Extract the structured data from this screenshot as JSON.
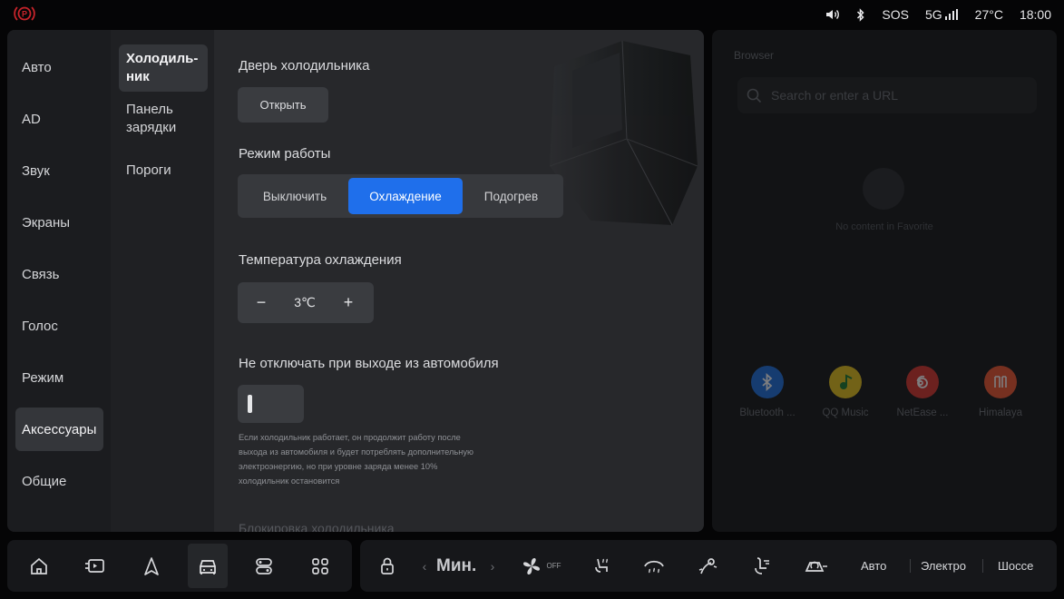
{
  "status_bar": {
    "icons": [
      "parking-brake-icon",
      "volume-icon",
      "bluetooth-icon",
      "signal-icon"
    ],
    "sos": "SOS",
    "network": "5G",
    "temperature": "27°C",
    "time": "18:00",
    "accent_color": "#c8242b"
  },
  "nav_primary": [
    {
      "label": "Авто"
    },
    {
      "label": "AD"
    },
    {
      "label": "Звук"
    },
    {
      "label": "Экраны"
    },
    {
      "label": "Связь"
    },
    {
      "label": "Голос"
    },
    {
      "label": "Режим"
    },
    {
      "label": "Аксессуары",
      "active": true
    },
    {
      "label": "Общие"
    }
  ],
  "nav_secondary": [
    {
      "label": "Холодиль-\nник",
      "active": true
    },
    {
      "label": "Панель\nзарядки"
    },
    {
      "label": "Пороги"
    }
  ],
  "fridge": {
    "door_label": "Дверь холодильника",
    "open_button": "Открыть",
    "mode_label": "Режим работы",
    "modes": [
      "Выключить",
      "Охлаждение",
      "Подогрев"
    ],
    "selected_mode": "Охлаждение",
    "temp_label": "Температура охлаждения",
    "temp_value": "3℃",
    "keep_on_label": "Не отключать при выходе из автомобиля",
    "keep_on_enabled": false,
    "keep_on_hint": "Если холодильник работает, он продолжит работу после выхода из автомобиля и будет потреблять дополнительную электроэнергию, но при уровне заряда менее 10% холодильник остановится",
    "lock_label": "Блокировка холодильника",
    "accent_color": "#1f6feb"
  },
  "browser": {
    "title": "Browser",
    "search_placeholder": "Search or enter a URL",
    "empty_text": "No content in Favorite",
    "apps": [
      {
        "name": "Bluetooth ...",
        "icon": "bluetooth-icon",
        "color": "#1d6fe0"
      },
      {
        "name": "QQ Music",
        "icon": "music-note-icon",
        "color": "#e8c21a"
      },
      {
        "name": "NetEase ...",
        "icon": "netease-icon",
        "color": "#d9322c"
      },
      {
        "name": "Himalaya",
        "icon": "himalaya-icon",
        "color": "#f0552f"
      }
    ]
  },
  "dock": {
    "left_icons": [
      "home-icon",
      "tablet-icon",
      "navigation-icon",
      "car-icon",
      "controls-icon",
      "apps-grid-icon"
    ],
    "selected": "car-icon",
    "lock_icon": "lock-icon",
    "fan_level": "Мин.",
    "fan_state": "OFF",
    "climate_icons": [
      "seat-heat-icon",
      "front-defrost-icon",
      "wind-direction-icon",
      "footwell-air-icon",
      "recirculation-icon"
    ],
    "modes": [
      "Авто",
      "Электро",
      "Шоссе"
    ]
  }
}
